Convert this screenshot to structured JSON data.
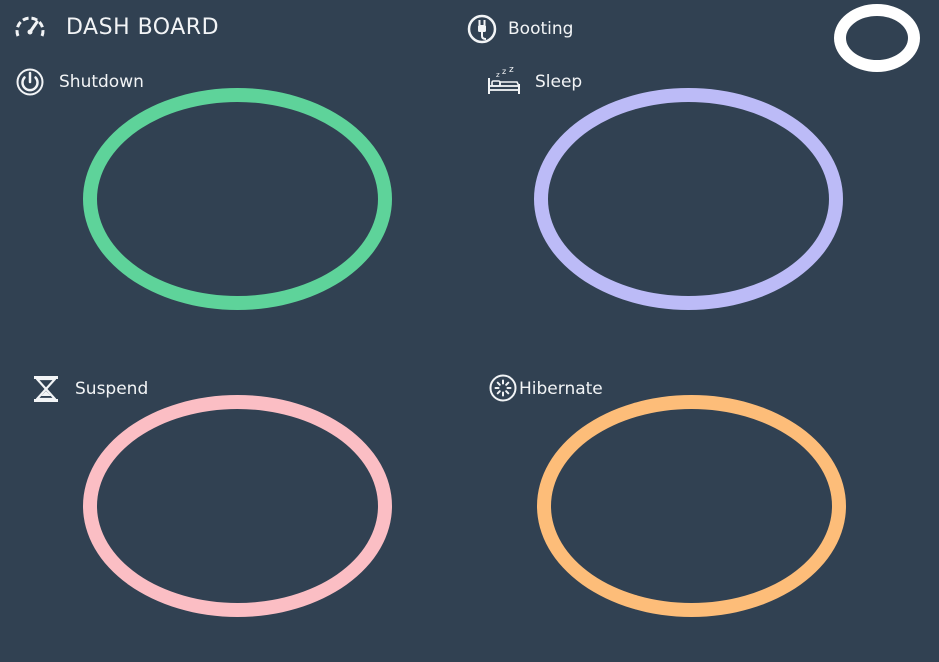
{
  "header": {
    "title": "DASH BOARD",
    "title_icon": "speedometer-icon",
    "booting_label": "Booting",
    "booting_icon": "power-plug-icon",
    "status_indicator_color": "#ffffff"
  },
  "states": [
    {
      "label": "Shutdown",
      "icon": "power-icon",
      "ring_color": "#5ed39a"
    },
    {
      "label": "Sleep",
      "icon": "bed-sleep-icon",
      "ring_color": "#bcbbf7"
    },
    {
      "label": "Suspend",
      "icon": "hourglass-icon",
      "ring_color": "#fbbec4"
    },
    {
      "label": "Hibernate",
      "icon": "spinner-icon",
      "ring_color": "#fdbd79"
    }
  ],
  "colors": {
    "background": "#314152",
    "text": "#f2f4f6"
  }
}
